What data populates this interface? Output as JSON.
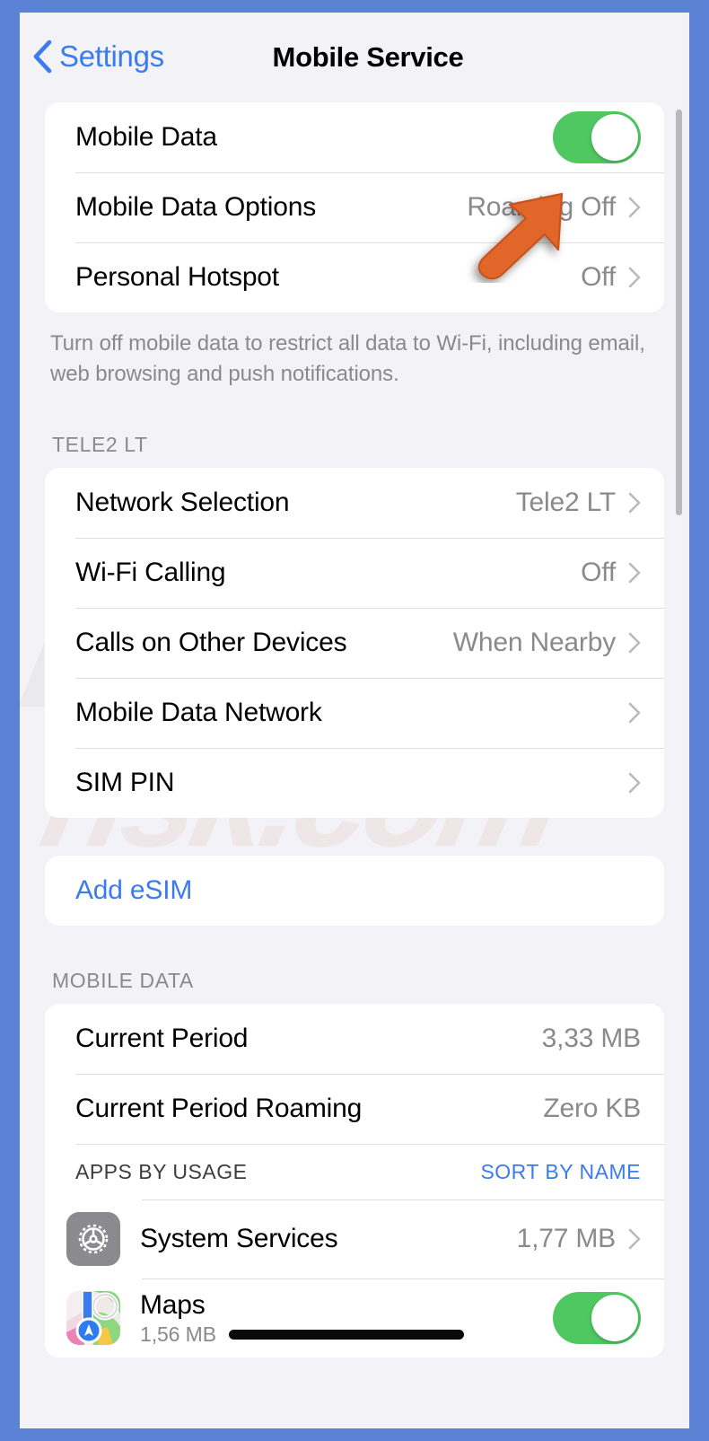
{
  "window": {
    "frame_color": "#5b82d4",
    "background": "#f2f2f7",
    "accent_blue": "#3b7cec",
    "toggle_green": "#4fc862",
    "secondary_text": "#8a8a8e"
  },
  "watermark": {
    "primary": "PC",
    "secondary": "risk.com"
  },
  "navbar": {
    "back_label": "Settings",
    "back_icon": "chevron-left-icon",
    "title": "Mobile Service"
  },
  "groups": [
    {
      "id": "data-group",
      "rows": [
        {
          "label": "Mobile Data",
          "control": "toggle",
          "value_on": true
        },
        {
          "label": "Mobile Data Options",
          "value": "Roaming Off",
          "control": "chevron"
        },
        {
          "label": "Personal Hotspot",
          "value": "Off",
          "control": "chevron"
        }
      ],
      "footnote": "Turn off mobile data to restrict all data to Wi-Fi, including email, web browsing and push notifications."
    },
    {
      "id": "carrier-group",
      "header": "TELE2 LT",
      "rows": [
        {
          "label": "Network Selection",
          "value": "Tele2 LT",
          "control": "chevron"
        },
        {
          "label": "Wi-Fi Calling",
          "value": "Off",
          "control": "chevron"
        },
        {
          "label": "Calls on Other Devices",
          "value": "When Nearby",
          "control": "chevron"
        },
        {
          "label": "Mobile Data Network",
          "value": "",
          "control": "chevron"
        },
        {
          "label": "SIM PIN",
          "value": "",
          "control": "chevron"
        }
      ]
    },
    {
      "id": "esim-group",
      "rows": [
        {
          "label": "Add eSIM",
          "control": "link"
        }
      ]
    },
    {
      "id": "mobile-data-group",
      "header": "MOBILE DATA",
      "rows": [
        {
          "label": "Current Period",
          "value": "3,33 MB",
          "control": "none"
        },
        {
          "label": "Current Period Roaming",
          "value": "Zero KB",
          "control": "none"
        }
      ],
      "usage_header": {
        "title": "APPS BY USAGE",
        "sort_label": "SORT BY NAME"
      },
      "apps": [
        {
          "name": "System Services",
          "icon": "gear-icon",
          "value": "1,77 MB",
          "control": "chevron",
          "size": ""
        },
        {
          "name": "Maps",
          "icon": "maps-icon",
          "value": "",
          "control": "toggle",
          "value_on": true,
          "size": "1,56 MB",
          "redacted": true
        }
      ]
    }
  ],
  "scrollbar": {
    "visible": true
  },
  "cursor": {
    "type": "arrow-cursor",
    "color": "#e06a2b",
    "direction": "up-right"
  }
}
